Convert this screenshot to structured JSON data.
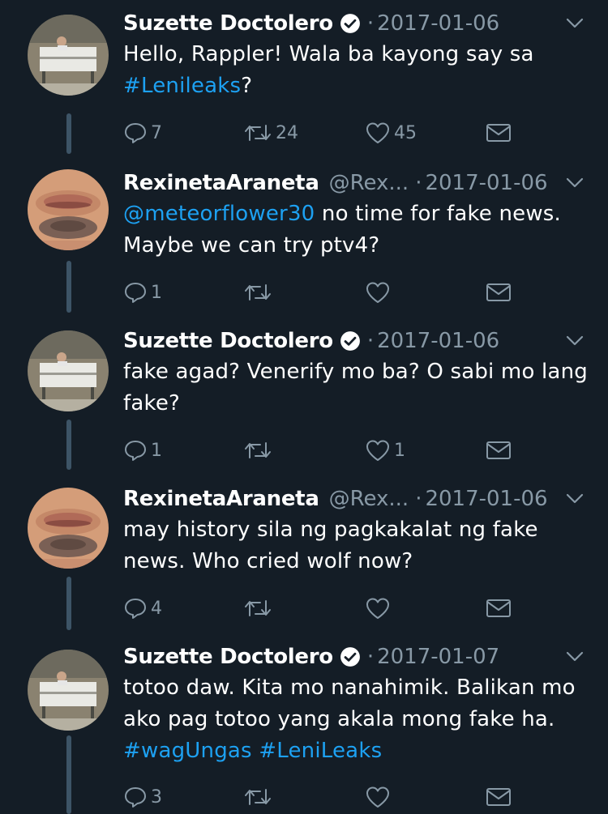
{
  "tweets": [
    {
      "name": "Suzette Doctolero",
      "verified": true,
      "handle": "",
      "separator": "·",
      "date": "2017-01-06",
      "text_parts": [
        "Hello, Rappler!  Wala ba kayong say sa ",
        "#Lenileaks",
        "?"
      ],
      "reply_count": "7",
      "retweet_count": "24",
      "like_count": "45"
    },
    {
      "name": "RexinetaAraneta",
      "verified": false,
      "handle": "@Rex...",
      "separator": "·",
      "date": "2017-01-06",
      "text_parts": [
        "@meteorflower30",
        " no time for fake news. Maybe we can try ptv4?"
      ],
      "reply_count": "1",
      "retweet_count": "",
      "like_count": ""
    },
    {
      "name": "Suzette Doctolero",
      "verified": true,
      "handle": "",
      "separator": "·",
      "date": "2017-01-06",
      "text_parts": [
        "fake agad? Venerify mo ba? O sabi mo lang fake?"
      ],
      "reply_count": "1",
      "retweet_count": "",
      "like_count": "1"
    },
    {
      "name": "RexinetaAraneta",
      "verified": false,
      "handle": "@Rex...",
      "separator": "·",
      "date": "2017-01-06",
      "text_parts": [
        "may history sila ng pagkakalat ng fake news. Who cried wolf now?"
      ],
      "reply_count": "4",
      "retweet_count": "",
      "like_count": ""
    },
    {
      "name": "Suzette Doctolero",
      "verified": true,
      "handle": "",
      "separator": "·",
      "date": "2017-01-07",
      "text_parts": [
        "totoo daw. Kita mo nanahimik. Balikan mo ako pag totoo yang akala mong fake ha.  ",
        "#wagUngas",
        " ",
        "#LeniLeaks"
      ],
      "reply_count": "3",
      "retweet_count": "",
      "like_count": ""
    }
  ],
  "colors": {
    "background": "#141d26",
    "text": "#ffffff",
    "muted": "#8899a6",
    "link": "#1da1f2",
    "thread_line": "#3d5466"
  }
}
